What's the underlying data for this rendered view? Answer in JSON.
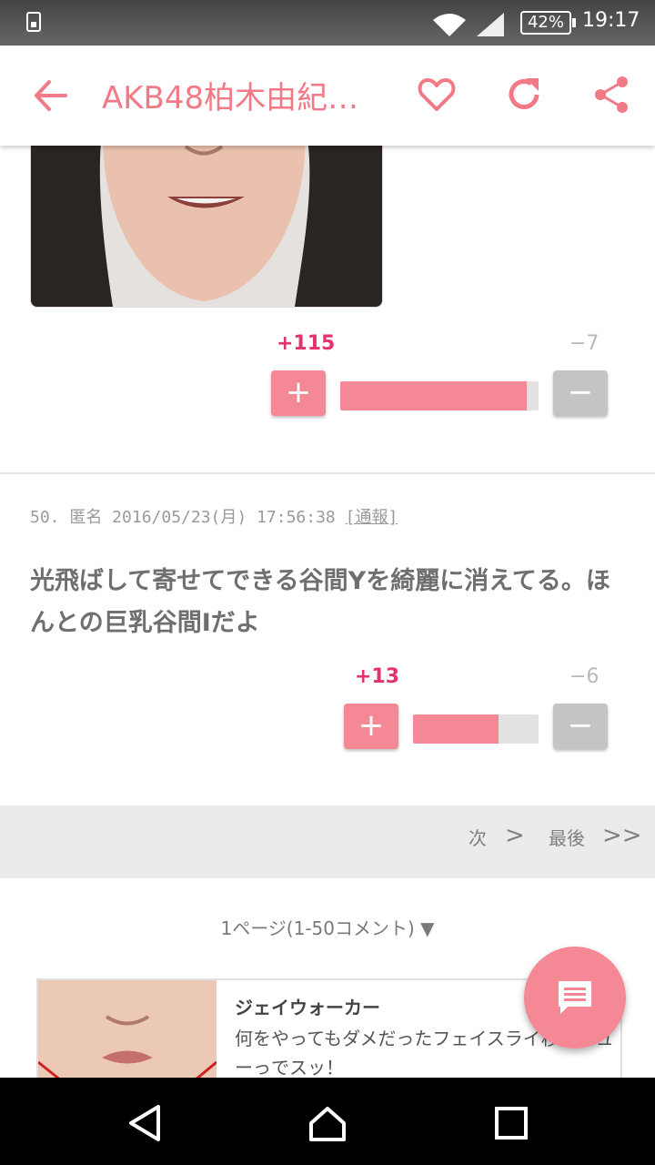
{
  "status_bar": {
    "battery": "42%",
    "time": "19:17",
    "icons": [
      "sim-icon",
      "wifi-icon",
      "signal-icon",
      "battery-icon"
    ]
  },
  "app_bar": {
    "title": "AKB48柏木由紀…",
    "accent_color": "#f27a86",
    "icons": [
      "back-arrow-icon",
      "heart-icon",
      "refresh-icon",
      "share-icon"
    ]
  },
  "previous_comment": {
    "plus_count": "+115",
    "minus_count": "−7",
    "plus_label": "+",
    "minus_label": "−",
    "positive_ratio": 0.94
  },
  "comment": {
    "meta": "50. 匿名 2016/05/23(月) 17:56:38 ",
    "report": "[通報]",
    "text": "光飛ばして寄せてできる谷間Yを綺麗に消えてる。ほんとの巨乳谷間Iだよ",
    "plus_count": "+13",
    "minus_count": "−6",
    "plus_label": "+",
    "minus_label": "−",
    "positive_ratio": 0.68
  },
  "pager": {
    "next": "次",
    "next_arrow": ">",
    "last": "最後",
    "last_arrow": ">>"
  },
  "page_select": "1ページ(1-50コメント) ▼",
  "ad": {
    "name": "ジェイウォーカー",
    "desc": "何をやってもダメだったフェイスライ秒のシューっでスッ！"
  },
  "nav_bar": {
    "icons": [
      "back-triangle-icon",
      "home-icon",
      "recents-icon"
    ]
  }
}
